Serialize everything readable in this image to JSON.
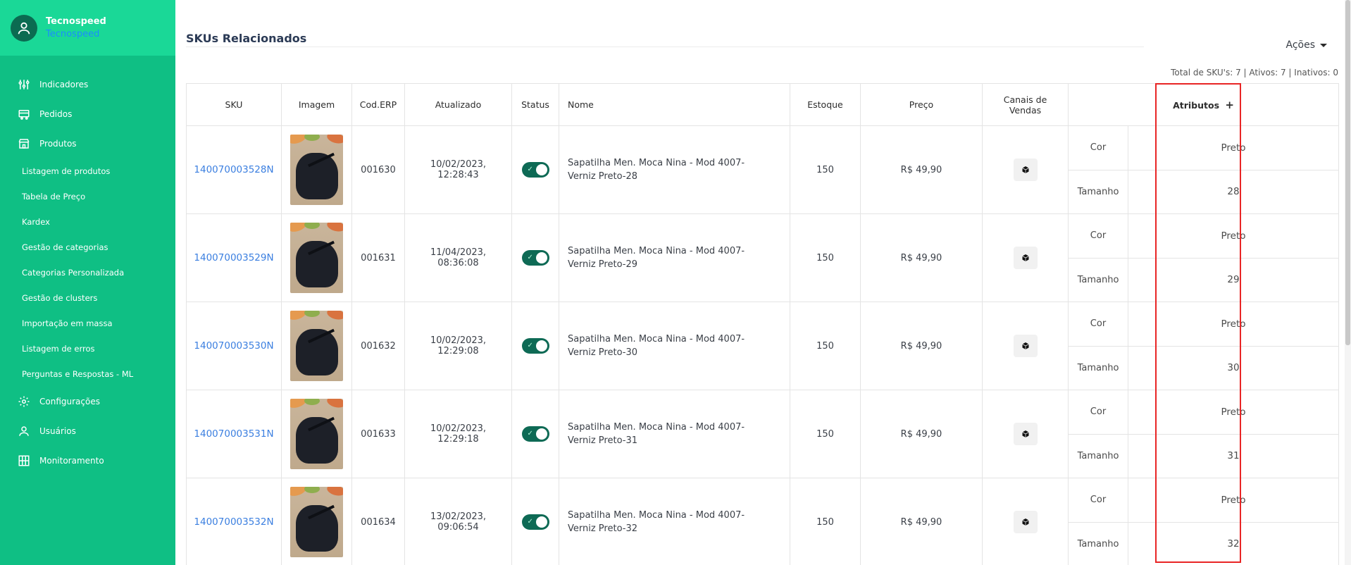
{
  "user": {
    "name": "Tecnospeed",
    "org": "Tecnospeed"
  },
  "nav": {
    "indicadores": "Indicadores",
    "pedidos": "Pedidos",
    "produtos": "Produtos",
    "sub": [
      "Listagem de produtos",
      "Tabela de Preço",
      "Kardex",
      "Gestão de categorias",
      "Categorias Personalizada",
      "Gestão de clusters",
      "Importação em massa",
      "Listagem de erros",
      "Perguntas e Respostas - ML"
    ],
    "configuracoes": "Configurações",
    "usuarios": "Usuários",
    "monitoramento": "Monitoramento"
  },
  "page": {
    "title": "SKUs Relacionados",
    "actions": "Ações",
    "summary": "Total de SKU's: 7 | Ativos: 7 | Inativos: 0"
  },
  "table": {
    "headers": {
      "sku": "SKU",
      "imagem": "Imagem",
      "cod_erp": "Cod.ERP",
      "atualizado": "Atualizado",
      "status": "Status",
      "nome": "Nome",
      "estoque": "Estoque",
      "preco": "Preço",
      "canais_1": "Canais de",
      "canais_2": "Vendas",
      "atributos": "Atributos",
      "atributos_plus": "+"
    },
    "rows": [
      {
        "sku": "140070003528N",
        "cod": "001630",
        "date": "10/02/2023,",
        "time": "12:28:43",
        "nome_1": "Sapatilha Men. Moca Nina - Mod 4007-",
        "nome_2": "Verniz Preto-28",
        "estoque": "150",
        "preco": "R$ 49,90",
        "attr1_key": "Cor",
        "attr1_val": "Preto",
        "attr2_key": "Tamanho",
        "attr2_val": "28"
      },
      {
        "sku": "140070003529N",
        "cod": "001631",
        "date": "11/04/2023,",
        "time": "08:36:08",
        "nome_1": "Sapatilha Men. Moca Nina - Mod 4007-",
        "nome_2": "Verniz Preto-29",
        "estoque": "150",
        "preco": "R$ 49,90",
        "attr1_key": "Cor",
        "attr1_val": "Preto",
        "attr2_key": "Tamanho",
        "attr2_val": "29"
      },
      {
        "sku": "140070003530N",
        "cod": "001632",
        "date": "10/02/2023,",
        "time": "12:29:08",
        "nome_1": "Sapatilha Men. Moca Nina - Mod 4007-",
        "nome_2": "Verniz Preto-30",
        "estoque": "150",
        "preco": "R$ 49,90",
        "attr1_key": "Cor",
        "attr1_val": "Preto",
        "attr2_key": "Tamanho",
        "attr2_val": "30"
      },
      {
        "sku": "140070003531N",
        "cod": "001633",
        "date": "10/02/2023,",
        "time": "12:29:18",
        "nome_1": "Sapatilha Men. Moca Nina - Mod 4007-",
        "nome_2": "Verniz Preto-31",
        "estoque": "150",
        "preco": "R$ 49,90",
        "attr1_key": "Cor",
        "attr1_val": "Preto",
        "attr2_key": "Tamanho",
        "attr2_val": "31"
      },
      {
        "sku": "140070003532N",
        "cod": "001634",
        "date": "13/02/2023,",
        "time": "09:06:54",
        "nome_1": "Sapatilha Men. Moca Nina - Mod 4007-",
        "nome_2": "Verniz Preto-32",
        "estoque": "150",
        "preco": "R$ 49,90",
        "attr1_key": "Cor",
        "attr1_val": "Preto",
        "attr2_key": "Tamanho",
        "attr2_val": "32"
      }
    ]
  },
  "colors": {
    "sidebar": "#0fbf84",
    "sidebar_header": "#1ad897",
    "toggle_on": "#0e6a55",
    "link": "#3b7fe0",
    "highlight": "#e82525"
  },
  "icons": {
    "avatar": "user-icon",
    "indicadores": "sliders-icon",
    "pedidos": "cart-icon",
    "produtos": "store-icon",
    "configuracoes": "gear-icon",
    "usuarios": "user-icon",
    "monitoramento": "grid-icon",
    "canal": "cube-icon",
    "status_check": "check-icon"
  }
}
